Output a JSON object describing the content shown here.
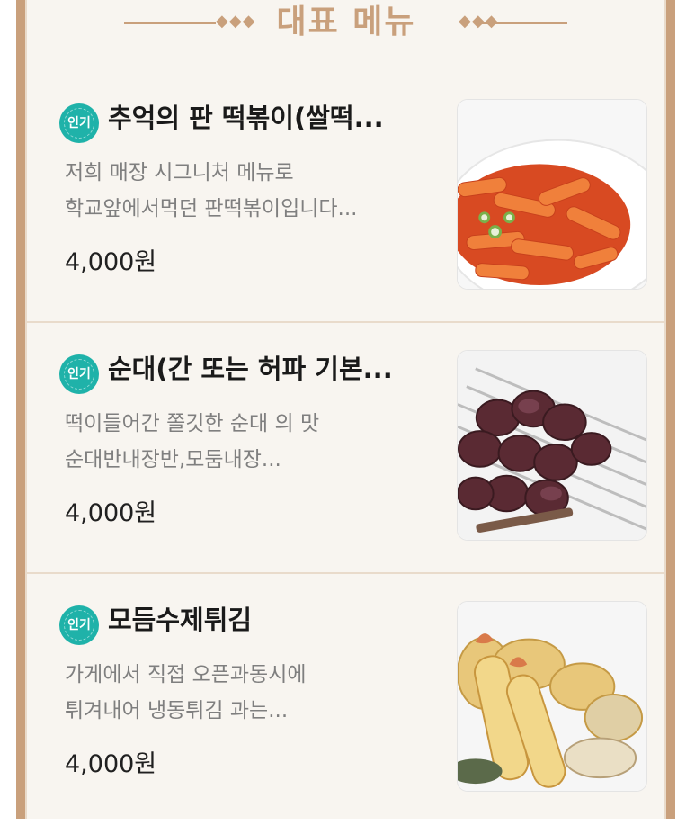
{
  "section": {
    "title": "대표 메뉴",
    "dots_left": "◆◆◆",
    "dots_right": "◆◆◆"
  },
  "menu": [
    {
      "badge": "인기",
      "name": "추억의 판 떡볶이(쌀떡...",
      "desc_line1": "저희 매장 시그니처 메뉴로",
      "desc_line2": "학교앞에서먹던 판떡볶이입니다...",
      "price": "4,000원",
      "image_icon": "tteokbokki-image"
    },
    {
      "badge": "인기",
      "name": "순대(간 또는 허파 기본...",
      "desc_line1": "떡이들어간 쫄깃한 순대 의 맛",
      "desc_line2": "순대반내장반,모둠내장...",
      "price": "4,000원",
      "image_icon": "sundae-image"
    },
    {
      "badge": "인기",
      "name": "모듬수제튀김",
      "desc_line1": "가게에서 직접 오픈과동시에",
      "desc_line2": "튀겨내어 냉동튀김 과는...",
      "price": "4,000원",
      "image_icon": "fried-food-image"
    }
  ],
  "colors": {
    "accent": "#c9a07c",
    "badge": "#1fb2a9",
    "background": "#f8f5f0"
  }
}
